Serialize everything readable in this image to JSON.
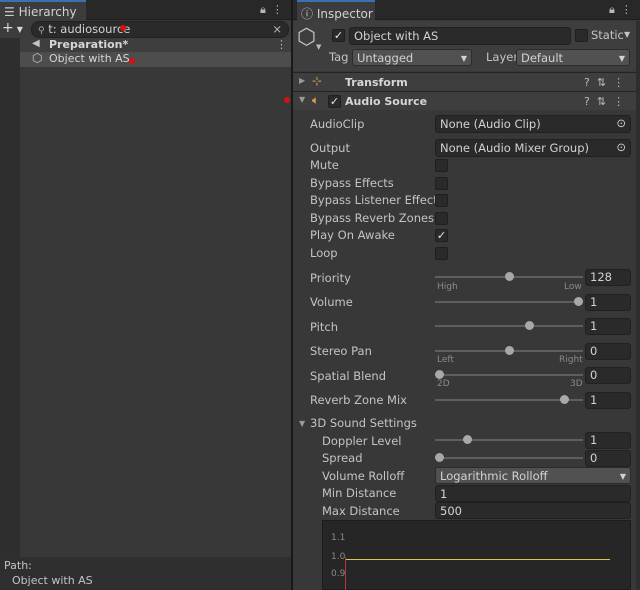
{
  "hierarchy": {
    "tab_title": "Hierarchy",
    "add_label": "+",
    "search_value": "t: audiosource",
    "clear_label": "×",
    "scene": {
      "name": "Preparation*"
    },
    "items": [
      {
        "name": "Object with AS"
      }
    ],
    "path_label": "Path:",
    "path_value": "Object with AS"
  },
  "inspector": {
    "tab_title": "Inspector",
    "object_name": "Object with AS",
    "static_label": "Static",
    "tag_label": "Tag",
    "tag_value": "Untagged",
    "layer_label": "Layer",
    "layer_value": "Default",
    "transform_title": "Transform",
    "audio_source_title": "Audio Source",
    "props": {
      "audioclip_label": "AudioClip",
      "audioclip_value": "None (Audio Clip)",
      "output_label": "Output",
      "output_value": "None (Audio Mixer Group)",
      "mute_label": "Mute",
      "bypass_effects_label": "Bypass Effects",
      "bypass_listener_label": "Bypass Listener Effects",
      "bypass_reverb_label": "Bypass Reverb Zones",
      "play_on_awake_label": "Play On Awake",
      "loop_label": "Loop",
      "priority_label": "Priority",
      "priority_value": "128",
      "priority_min_label": "High",
      "priority_max_label": "Low",
      "volume_label": "Volume",
      "volume_value": "1",
      "pitch_label": "Pitch",
      "pitch_value": "1",
      "stereo_pan_label": "Stereo Pan",
      "stereo_pan_value": "0",
      "stereo_left_label": "Left",
      "stereo_right_label": "Right",
      "spatial_blend_label": "Spatial Blend",
      "spatial_blend_value": "0",
      "spatial_2d_label": "2D",
      "spatial_3d_label": "3D",
      "reverb_mix_label": "Reverb Zone Mix",
      "reverb_mix_value": "1"
    },
    "sound3d": {
      "title": "3D Sound Settings",
      "doppler_label": "Doppler Level",
      "doppler_value": "1",
      "spread_label": "Spread",
      "spread_value": "0",
      "rolloff_label": "Volume Rolloff",
      "rolloff_value": "Logarithmic Rolloff",
      "min_dist_label": "Min Distance",
      "min_dist_value": "1",
      "max_dist_label": "Max Distance",
      "max_dist_value": "500"
    },
    "graph": {
      "tick_top": "1.1",
      "tick_mid": "1.0",
      "tick_low": "0.9"
    }
  },
  "slider_levels": {
    "priority": 0.5,
    "volume": 1.0,
    "pitch": 0.65,
    "stereo_pan": 0.5,
    "spatial_blend": 0.0,
    "reverb_mix": 0.9,
    "doppler": 0.2,
    "spread": 0.0
  },
  "colors": {
    "selection": "#4d4d4d",
    "marker": "#d31111",
    "accent_tab": "#3a72b0",
    "curve": "#d4c84e"
  }
}
